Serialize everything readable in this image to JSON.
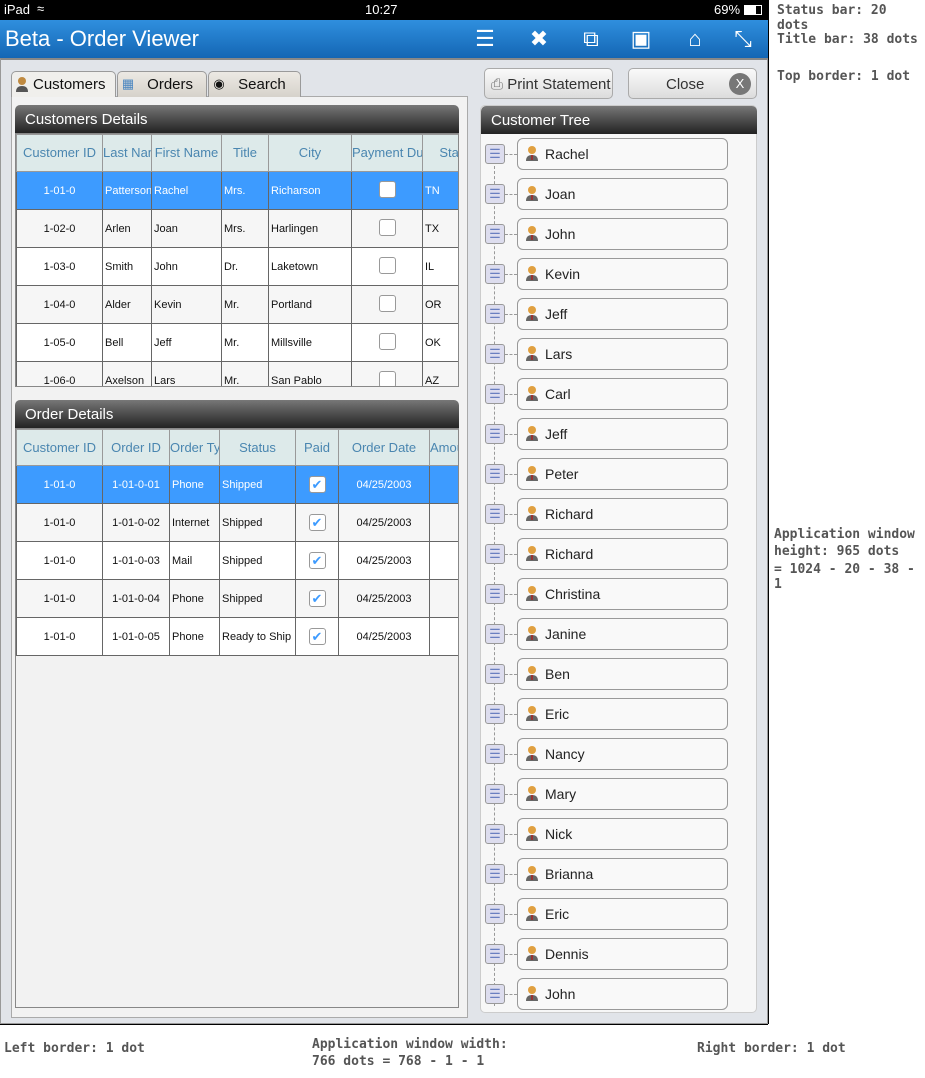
{
  "status_bar": {
    "device": "iPad",
    "time": "10:27",
    "battery": "69%"
  },
  "title_bar": {
    "title": "Beta - Order Viewer",
    "icons": [
      "database-icon",
      "tools-icon",
      "windows-icon",
      "window-icon",
      "home-icon",
      "expand-icon"
    ]
  },
  "tabs": [
    {
      "label": "Customers",
      "icon": "person-icon"
    },
    {
      "label": "Orders",
      "icon": "calendar-icon"
    },
    {
      "label": "Search",
      "icon": "binoculars-icon"
    }
  ],
  "buttons": {
    "print": "Print Statement",
    "close": "Close",
    "close_glyph": "X"
  },
  "customers": {
    "title": "Customers Details",
    "columns": [
      "Customer ID",
      "Last Name",
      "First Name",
      "Title",
      "City",
      "Payment Due",
      "State"
    ],
    "rows": [
      [
        "1-01-0",
        "Patterson",
        "Rachel",
        "Mrs.",
        "Richarson",
        false,
        "TN"
      ],
      [
        "1-02-0",
        "Arlen",
        "Joan",
        "Mrs.",
        "Harlingen",
        false,
        "TX"
      ],
      [
        "1-03-0",
        "Smith",
        "John",
        "Dr.",
        "Laketown",
        false,
        "IL"
      ],
      [
        "1-04-0",
        "Alder",
        "Kevin",
        "Mr.",
        "Portland",
        false,
        "OR"
      ],
      [
        "1-05-0",
        "Bell",
        "Jeff",
        "Mr.",
        "Millsville",
        false,
        "OK"
      ],
      [
        "1-06-0",
        "Axelson",
        "Lars",
        "Mr.",
        "San Pablo",
        false,
        "AZ"
      ]
    ]
  },
  "orders": {
    "title": "Order Details",
    "columns": [
      "Customer ID",
      "Order ID",
      "Order Type",
      "Status",
      "Paid",
      "Order Date",
      "Amount (U"
    ],
    "rows": [
      [
        "1-01-0",
        "1-01-0-01",
        "Phone",
        "Shipped",
        true,
        "04/25/2003",
        ""
      ],
      [
        "1-01-0",
        "1-01-0-02",
        "Internet",
        "Shipped",
        true,
        "04/25/2003",
        ""
      ],
      [
        "1-01-0",
        "1-01-0-03",
        "Mail",
        "Shipped",
        true,
        "04/25/2003",
        ""
      ],
      [
        "1-01-0",
        "1-01-0-04",
        "Phone",
        "Shipped",
        true,
        "04/25/2003",
        ""
      ],
      [
        "1-01-0",
        "1-01-0-05",
        "Phone",
        "Ready to Ship",
        true,
        "04/25/2003",
        ""
      ]
    ]
  },
  "tree": {
    "title": "Customer Tree",
    "nodes": [
      "Rachel",
      "Joan",
      "John",
      "Kevin",
      "Jeff",
      "Lars",
      "Carl",
      "Jeff",
      "Peter",
      "Richard",
      "Richard",
      "Christina",
      "Janine",
      "Ben",
      "Eric",
      "Nancy",
      "Mary",
      "Nick",
      "Brianna",
      "Eric",
      "Dennis",
      "John"
    ]
  },
  "annotations": {
    "status": "Status bar: 20 dots",
    "title": "Title bar: 38 dots",
    "top": "Top border: 1 dot",
    "height1": "Application window",
    "height2": "height: 965 dots",
    "height3": "= 1024 - 20 - 38 - 1",
    "left": "Left border: 1 dot",
    "width1": "Application window width:",
    "width2": "766 dots = 768 - 1 - 1",
    "right": "Right border: 1 dot"
  },
  "colors": {
    "titlebar": "#1f7ccc",
    "selection": "#3d9bff",
    "header_text": "#4a86b0"
  }
}
